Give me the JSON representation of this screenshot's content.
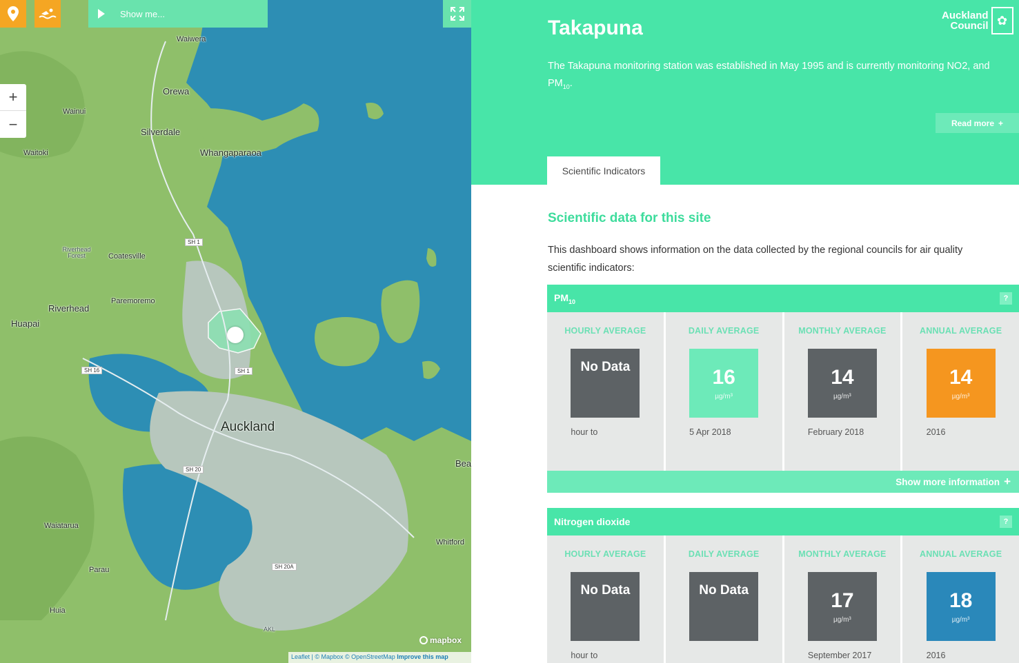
{
  "map": {
    "show_me_label": "Show me...",
    "zoom_in": "+",
    "zoom_out": "−",
    "attribution": {
      "leaflet": "Leaflet",
      "mapbox": "© Mapbox",
      "osm": "© OpenStreetMap",
      "improve": "Improve this map"
    },
    "logo_text": "mapbox",
    "places": [
      "Waiwera",
      "Orewa",
      "Wainui",
      "Silverdale",
      "Whangaparaoa",
      "Waitoki",
      "Riverhead Forest",
      "Coatesville",
      "Paremoremo",
      "Riverhead",
      "Huapai",
      "Auckland",
      "Bea",
      "Waiatarua",
      "Whitford",
      "Parau",
      "Huia",
      "AKL"
    ],
    "roads": [
      "SH 1",
      "SH 16",
      "SH 1",
      "SH 20",
      "SH 20A"
    ],
    "colors": {
      "water": "#2d8eb4",
      "land": "#8fbf6a",
      "urban": "#b7c7bd",
      "accent": "#f5a623"
    }
  },
  "site": {
    "title": "Takapuna",
    "description_main": "The Takapuna monitoring station was established in May 1995 and is currently monitoring NO2, and PM",
    "description_sub": "10",
    "description_end": ".",
    "read_more": "Read more",
    "logo_line1": "Auckland",
    "logo_line2": "Council"
  },
  "tabs": [
    {
      "label": "Scientific Indicators",
      "active": true
    }
  ],
  "content": {
    "title": "Scientific data for this site",
    "intro": "This dashboard shows information on the data collected by the regional councils for air quality scientific indicators:"
  },
  "sections": [
    {
      "title_main": "PM",
      "title_sub": "10",
      "help": "?",
      "show_more": "Show more information",
      "cards": [
        {
          "label": "HOURLY AVERAGE",
          "value": "No Data",
          "unit": "",
          "date": "hour to",
          "color": "#5d6265"
        },
        {
          "label": "DAILY AVERAGE",
          "value": "16",
          "unit": "µg/m³",
          "date": "5 Apr 2018",
          "color": "#6deab9"
        },
        {
          "label": "MONTHLY AVERAGE",
          "value": "14",
          "unit": "µg/m³",
          "date": "February 2018",
          "color": "#5d6265"
        },
        {
          "label": "ANNUAL AVERAGE",
          "value": "14",
          "unit": "µg/m³",
          "date": "2016",
          "color": "#f5961f"
        }
      ]
    },
    {
      "title_main": "Nitrogen dioxide",
      "title_sub": "",
      "help": "?",
      "cards": [
        {
          "label": "HOURLY AVERAGE",
          "value": "No Data",
          "unit": "",
          "date": "hour to",
          "color": "#5d6265"
        },
        {
          "label": "DAILY AVERAGE",
          "value": "No Data",
          "unit": "",
          "date": "",
          "color": "#5d6265"
        },
        {
          "label": "MONTHLY AVERAGE",
          "value": "17",
          "unit": "µg/m³",
          "date": "September 2017",
          "color": "#5d6265"
        },
        {
          "label": "ANNUAL AVERAGE",
          "value": "18",
          "unit": "µg/m³",
          "date": "2016",
          "color": "#2a88ba"
        }
      ]
    }
  ]
}
